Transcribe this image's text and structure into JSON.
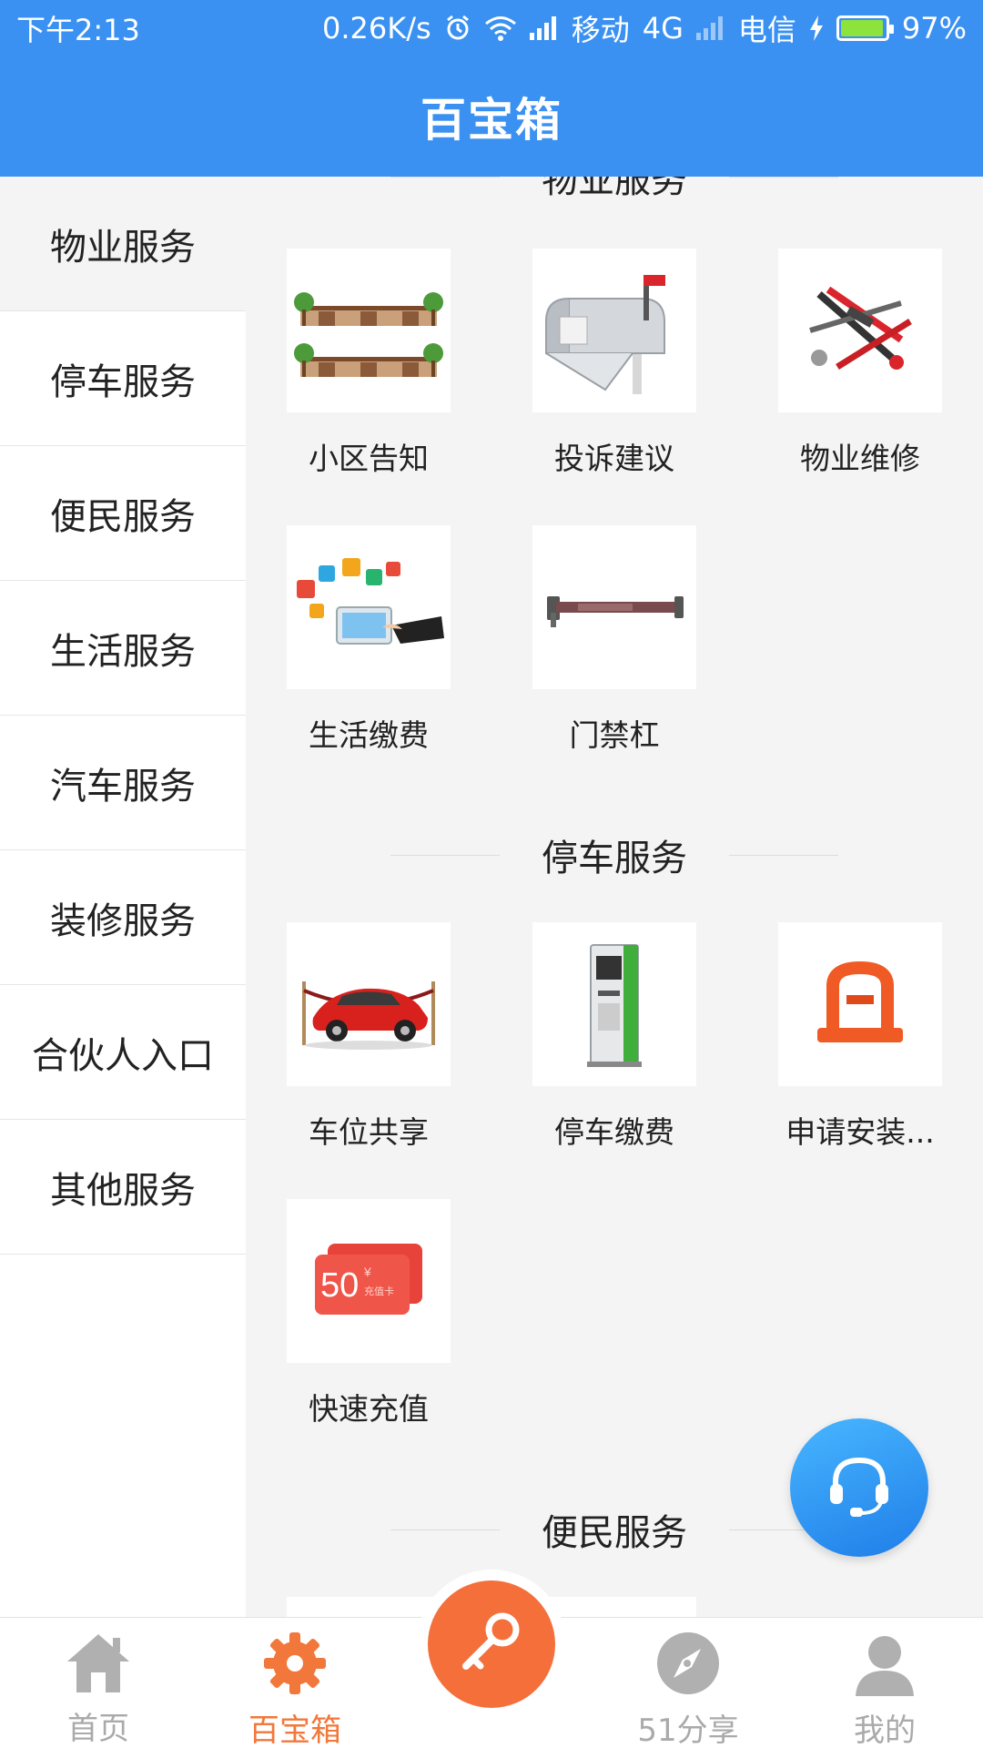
{
  "status_bar": {
    "time": "下午2:13",
    "net_speed": "0.26K/s",
    "carrier1": "移动",
    "net_type": "4G",
    "carrier2": "电信",
    "battery": "97%",
    "battery_level": 0.97,
    "battery_color": "#8ee23c"
  },
  "header": {
    "title": "百宝箱",
    "bg_color": "#3a91f1"
  },
  "sidebar": {
    "items": [
      {
        "label": "物业服务"
      },
      {
        "label": "停车服务"
      },
      {
        "label": "便民服务"
      },
      {
        "label": "生活服务"
      },
      {
        "label": "汽车服务"
      },
      {
        "label": "装修服务"
      },
      {
        "label": "合伙人入口"
      },
      {
        "label": "其他服务"
      }
    ]
  },
  "sections": [
    {
      "title": "物业服务",
      "items": [
        {
          "label": "小区告知",
          "icon": "community-notice-icon"
        },
        {
          "label": "投诉建议",
          "icon": "mailbox-icon"
        },
        {
          "label": "物业维修",
          "icon": "tools-icon"
        },
        {
          "label": "生活缴费",
          "icon": "life-payment-icon"
        },
        {
          "label": "门禁杠",
          "icon": "gate-bar-icon"
        }
      ]
    },
    {
      "title": "停车服务",
      "items": [
        {
          "label": "车位共享",
          "icon": "car-icon"
        },
        {
          "label": "停车缴费",
          "icon": "parking-kiosk-icon"
        },
        {
          "label": "申请安装...",
          "icon": "parking-lock-icon"
        },
        {
          "label": "快速充值",
          "icon": "recharge-card-icon"
        }
      ]
    },
    {
      "title": "便民服务",
      "items": []
    }
  ],
  "recharge_card": {
    "amount": "50",
    "currency": "¥",
    "caption": "充值卡"
  },
  "bottom_nav": {
    "items": [
      {
        "label": "首页",
        "icon": "home-icon"
      },
      {
        "label": "百宝箱",
        "icon": "gear-icon"
      },
      {
        "label": "51分享",
        "icon": "compass-icon"
      },
      {
        "label": "我的",
        "icon": "user-icon"
      }
    ],
    "center_icon": "key-icon",
    "active_color": "#f2773a",
    "inactive_color": "#aaaaaa"
  },
  "fab": {
    "icon": "customer-service-icon"
  }
}
